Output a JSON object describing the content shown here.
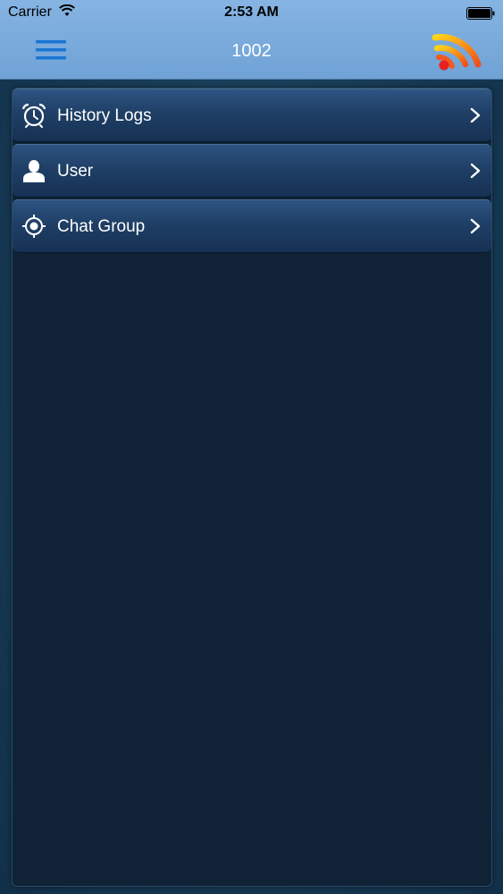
{
  "status_bar": {
    "carrier": "Carrier",
    "time": "2:53 AM"
  },
  "navbar": {
    "title": "1002",
    "menu_icon": "hamburger-menu-icon",
    "right_icon": "rss-feed-icon"
  },
  "menu": {
    "items": [
      {
        "label": "History Logs",
        "icon": "alarm-clock-icon"
      },
      {
        "label": "User",
        "icon": "user-icon"
      },
      {
        "label": "Chat Group",
        "icon": "target-icon"
      }
    ]
  },
  "colors": {
    "navbar": "#78a9dc",
    "accent_menu": "#1a75d2",
    "background": "#173a55",
    "panel": "#0f2236"
  }
}
